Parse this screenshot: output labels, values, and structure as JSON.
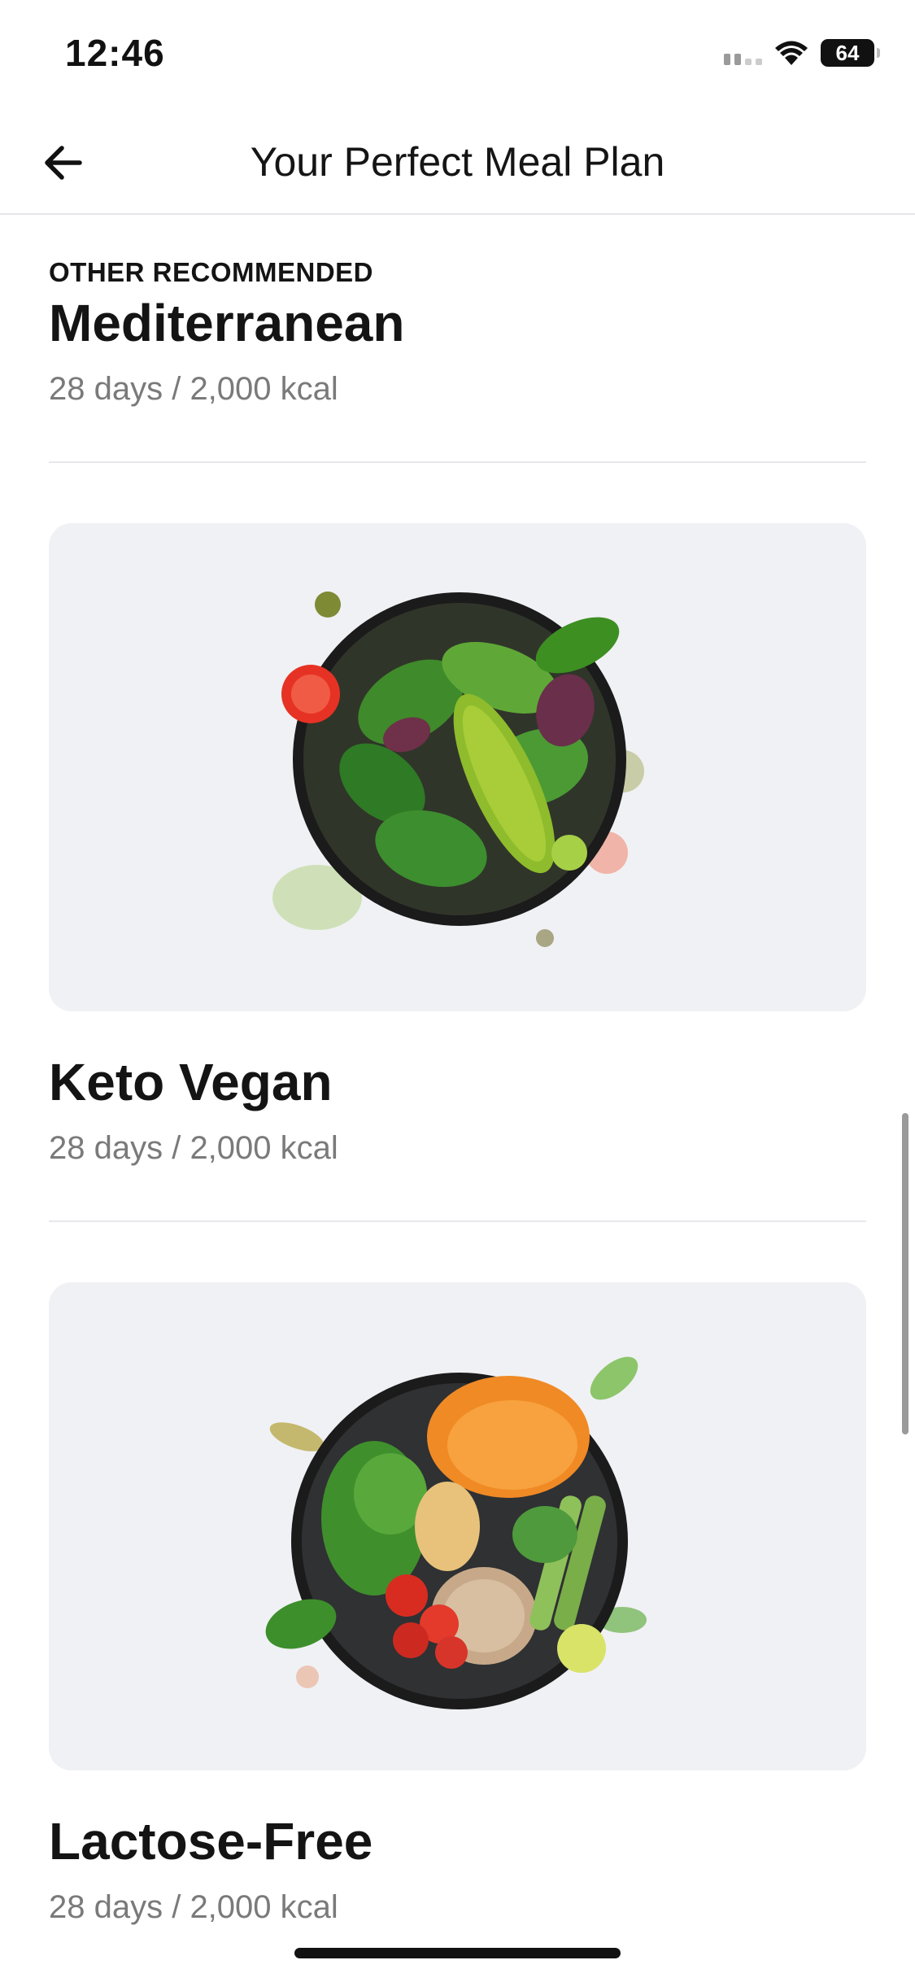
{
  "status_bar": {
    "time": "12:46",
    "battery": "64",
    "signal_icon": "cellular-signal-icon",
    "wifi_icon": "wifi-icon"
  },
  "header": {
    "title": "Your Perfect Meal Plan",
    "back_icon": "arrow-left-icon"
  },
  "plans": [
    {
      "eyebrow": "OTHER RECOMMENDED",
      "name": "Mediterranean",
      "meta": "28 days / 2,000 kcal"
    },
    {
      "name": "Keto Vegan",
      "meta": "28 days / 2,000 kcal",
      "image": "green-salad-bowl"
    },
    {
      "name": "Lactose-Free",
      "meta": "28 days / 2,000 kcal",
      "image": "squash-quinoa-bowl"
    }
  ],
  "colors": {
    "card_bg": "#f0f1f4",
    "text_primary": "#141414",
    "text_secondary": "#7a7a7a",
    "divider": "#e8e8ec"
  }
}
